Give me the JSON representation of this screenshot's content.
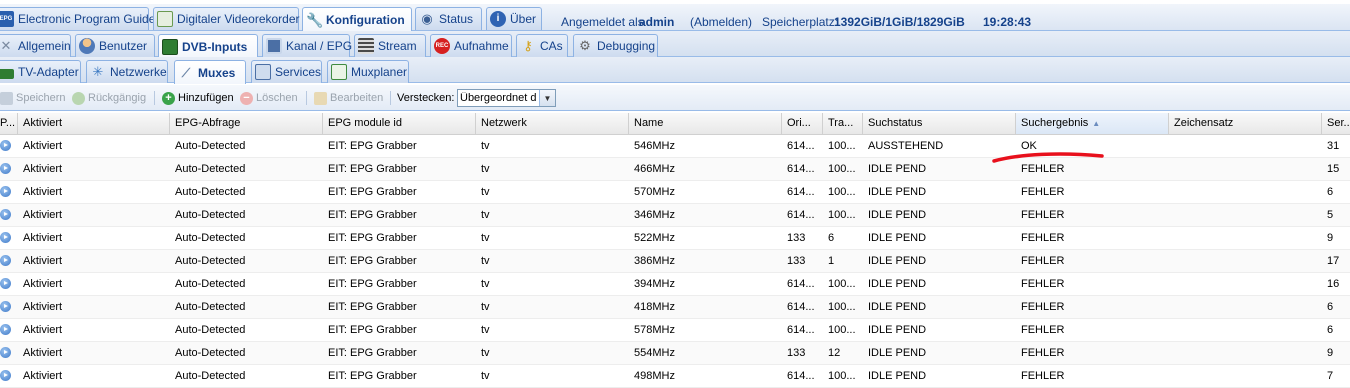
{
  "top_tabs": [
    {
      "label": "Electronic Program Guide",
      "icon": "epg-icon"
    },
    {
      "label": "Digitaler Videorekorder",
      "icon": "download-icon"
    },
    {
      "label": "Konfiguration",
      "icon": "wrench-icon"
    },
    {
      "label": "Status",
      "icon": "eye-icon"
    },
    {
      "label": "Über",
      "icon": "info-icon"
    }
  ],
  "login": {
    "prefix": "Angemeldet als",
    "user": "admin",
    "logout": "(Abmelden)"
  },
  "storage": {
    "label": "Speicherplatz:",
    "value": "1392GiB/1GiB/1829GiB"
  },
  "clock": "19:28:43",
  "config_tabs": [
    {
      "label": "Allgemein",
      "icon": "tools-icon"
    },
    {
      "label": "Benutzer",
      "icon": "users-icon"
    },
    {
      "label": "DVB-Inputs",
      "icon": "dvb-card-icon"
    },
    {
      "label": "Kanal / EPG",
      "icon": "tv-icon"
    },
    {
      "label": "Stream",
      "icon": "stream-icon"
    },
    {
      "label": "Aufnahme",
      "icon": "rec-icon"
    },
    {
      "label": "CAs",
      "icon": "key-icon"
    },
    {
      "label": "Debugging",
      "icon": "bug-icon"
    }
  ],
  "dvb_tabs": [
    {
      "label": "TV-Adapter",
      "icon": "adapter-icon"
    },
    {
      "label": "Netzwerke",
      "icon": "network-icon"
    },
    {
      "label": "Muxes",
      "icon": "mux-icon"
    },
    {
      "label": "Services",
      "icon": "services-icon"
    },
    {
      "label": "Muxplaner",
      "icon": "scheduler-icon"
    }
  ],
  "toolbar": {
    "save": "Speichern",
    "undo": "Rückgängig",
    "add": "Hinzufügen",
    "delete": "Löschen",
    "edit": "Bearbeiten",
    "hide_label": "Verstecken:",
    "hide_value": "Übergeordnet d"
  },
  "columns": [
    "P...",
    "Aktiviert",
    "EPG-Abfrage",
    "EPG module id",
    "Netzwerk",
    "Name",
    "Ori...",
    "Tra...",
    "Suchstatus",
    "Suchergebnis",
    "Zeichensatz",
    "Ser..."
  ],
  "rows": [
    [
      "Aktiviert",
      "Auto-Detected",
      "EIT: EPG Grabber",
      "tv",
      "546MHz",
      "614...",
      "100...",
      "AUSSTEHEND",
      "OK",
      "",
      "31"
    ],
    [
      "Aktiviert",
      "Auto-Detected",
      "EIT: EPG Grabber",
      "tv",
      "466MHz",
      "614...",
      "100...",
      "IDLE PEND",
      "FEHLER",
      "",
      "15"
    ],
    [
      "Aktiviert",
      "Auto-Detected",
      "EIT: EPG Grabber",
      "tv",
      "570MHz",
      "614...",
      "100...",
      "IDLE PEND",
      "FEHLER",
      "",
      "6"
    ],
    [
      "Aktiviert",
      "Auto-Detected",
      "EIT: EPG Grabber",
      "tv",
      "346MHz",
      "614...",
      "100...",
      "IDLE PEND",
      "FEHLER",
      "",
      "5"
    ],
    [
      "Aktiviert",
      "Auto-Detected",
      "EIT: EPG Grabber",
      "tv",
      "522MHz",
      "133",
      "6",
      "IDLE PEND",
      "FEHLER",
      "",
      "9"
    ],
    [
      "Aktiviert",
      "Auto-Detected",
      "EIT: EPG Grabber",
      "tv",
      "386MHz",
      "133",
      "1",
      "IDLE PEND",
      "FEHLER",
      "",
      "17"
    ],
    [
      "Aktiviert",
      "Auto-Detected",
      "EIT: EPG Grabber",
      "tv",
      "394MHz",
      "614...",
      "100...",
      "IDLE PEND",
      "FEHLER",
      "",
      "16"
    ],
    [
      "Aktiviert",
      "Auto-Detected",
      "EIT: EPG Grabber",
      "tv",
      "418MHz",
      "614...",
      "100...",
      "IDLE PEND",
      "FEHLER",
      "",
      "6"
    ],
    [
      "Aktiviert",
      "Auto-Detected",
      "EIT: EPG Grabber",
      "tv",
      "578MHz",
      "614...",
      "100...",
      "IDLE PEND",
      "FEHLER",
      "",
      "6"
    ],
    [
      "Aktiviert",
      "Auto-Detected",
      "EIT: EPG Grabber",
      "tv",
      "554MHz",
      "133",
      "12",
      "IDLE PEND",
      "FEHLER",
      "",
      "9"
    ],
    [
      "Aktiviert",
      "Auto-Detected",
      "EIT: EPG Grabber",
      "tv",
      "498MHz",
      "614...",
      "100...",
      "IDLE PEND",
      "FEHLER",
      "",
      "7"
    ]
  ],
  "colors": {
    "accent": "#15428b",
    "border": "#99bbe8",
    "annotation": "#e8101c"
  }
}
